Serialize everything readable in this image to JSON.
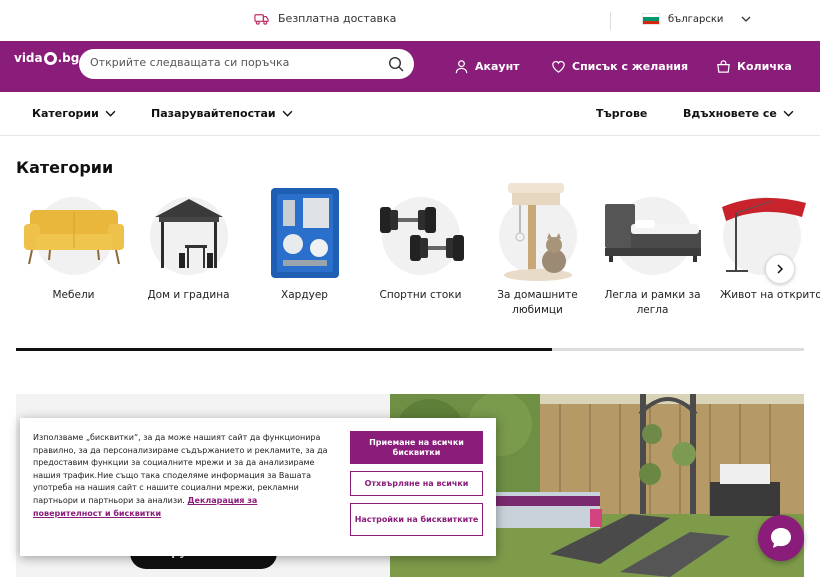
{
  "topbar": {
    "shipping_text": "Безплатна доставка",
    "language": "български",
    "flag_colors": [
      "#ffffff",
      "#00966e",
      "#d62612"
    ]
  },
  "header": {
    "logo_text": "vidaXL.bg",
    "search_placeholder": "Открийте следващата си поръчка",
    "account_label": "Акаунт",
    "wishlist_label": "Списък с желания",
    "cart_label": "Количка",
    "brand_color": "#8a1d7a"
  },
  "nav": {
    "categories": "Категории",
    "shop_posts": "Пазарувайтепостаи",
    "deals": "Търгове",
    "inspire": "Вдъхновете се"
  },
  "categories": {
    "title": "Категории",
    "items": [
      {
        "label": "Мебели",
        "icon": "sofa-image"
      },
      {
        "label": "Дом и градина",
        "icon": "gazebo-image"
      },
      {
        "label": "Хардуер",
        "icon": "toolcase-image"
      },
      {
        "label": "Спортни стоки",
        "icon": "dumbbells-image"
      },
      {
        "label": "За домашните любимци",
        "icon": "cat-tree-image"
      },
      {
        "label": "Легла и рамки за легла",
        "icon": "bed-image"
      },
      {
        "label": "Живот на открито",
        "icon": "umbrella-image"
      }
    ],
    "scroll_progress": 0.68
  },
  "hero": {
    "button_label": "Пазарувайте сега >"
  },
  "cookie": {
    "text": "Използваме „бисквитки“, за да може нашият сайт да функционира правилно, за да персонализираме съдържанието и рекламите, за да предоставим функции за социалните мрежи и за да анализираме нашия трафик.Ние също така споделяме информация за Вашата употреба на нашия сайт с нашите социални мрежи, рекламни партньори и партньори за анализи.",
    "link": "Декларация за поверителност и бисквитки",
    "accept_all": "Приемане на всички бисквитки",
    "reject_all": "Отхвърляне на всички",
    "settings": "Настройки на бисквитките"
  }
}
